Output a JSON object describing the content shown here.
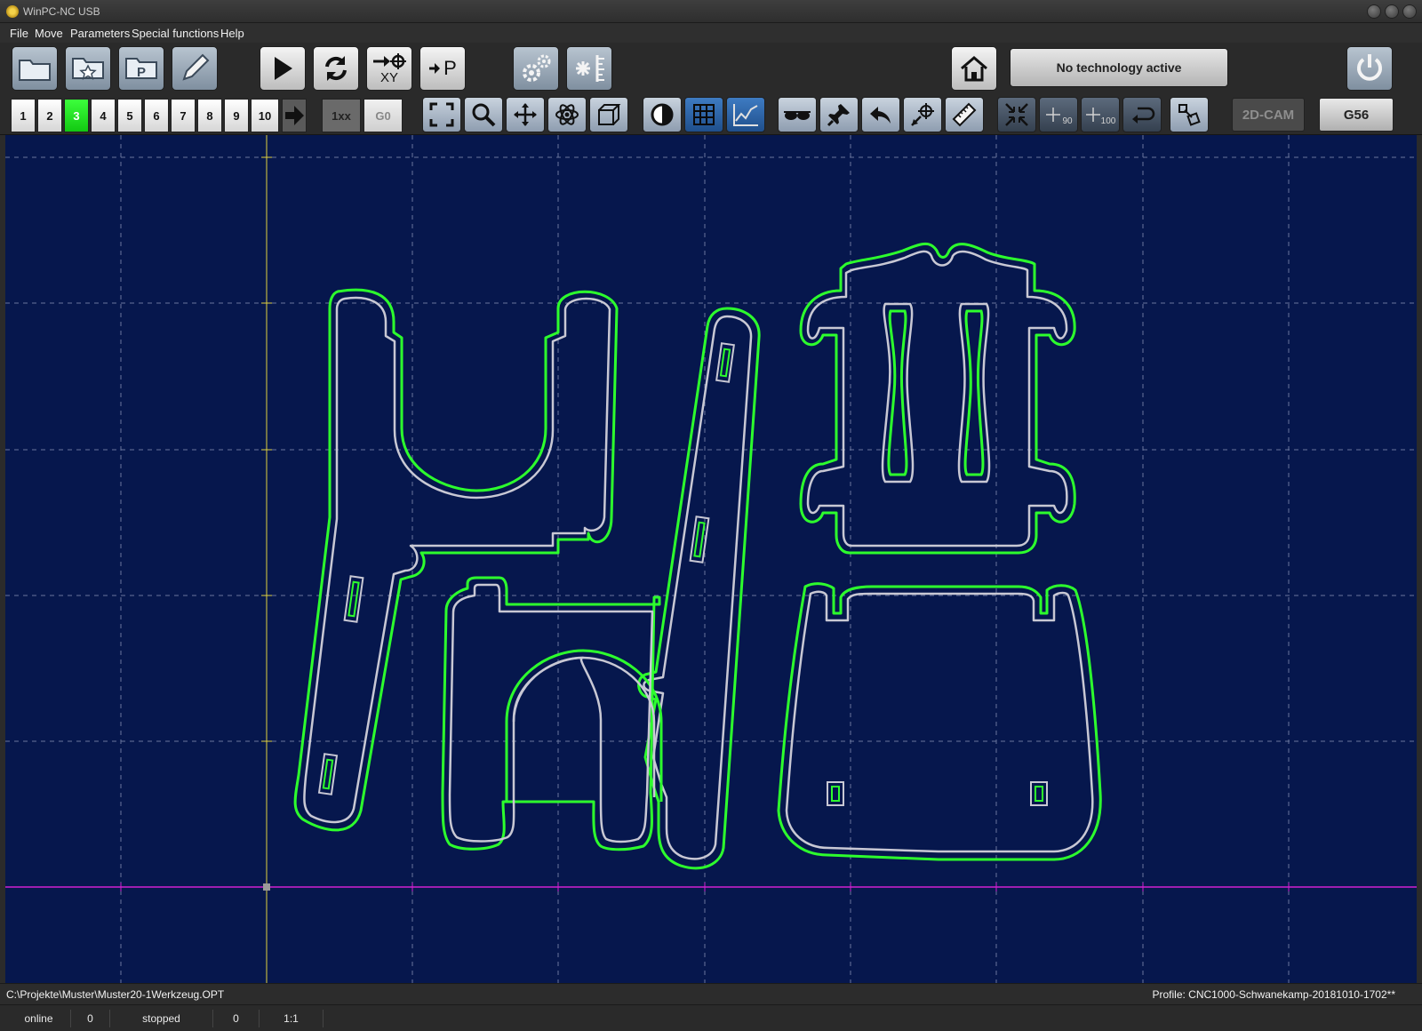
{
  "window": {
    "title": "WinPC-NC USB"
  },
  "menu": {
    "items": [
      "File",
      "Move",
      "Parameters",
      "Special functions",
      "Help"
    ]
  },
  "toolbar1": {
    "buttons": [
      "open-folder-icon",
      "favorites-folder-icon",
      "parameter-folder-icon",
      "edit-pencil-icon",
      "start-play-icon",
      "repeat-icon",
      "goto-xy-icon",
      "goto-park-icon",
      "settings-gears-icon",
      "star-ruler-icon",
      "home-icon",
      "power-icon"
    ],
    "xy_label": "XY",
    "park_label": "P",
    "technology_status": "No technology active"
  },
  "toolbar2": {
    "tool_numbers": [
      "1",
      "2",
      "3",
      "4",
      "5",
      "6",
      "7",
      "8",
      "9",
      "10"
    ],
    "active_tool": "3",
    "mode_1xx": "1xx",
    "mode_g0": "G0",
    "view_buttons": [
      "fit-view-icon",
      "zoom-icon",
      "pan-icon",
      "atom-icon",
      "3d-box-icon",
      "contrast-icon",
      "grid-icon",
      "chart-icon",
      "glasses-icon",
      "pin-icon",
      "undo-arrow-icon",
      "target-arrow-icon",
      "ruler-icon",
      "shrink-icon",
      "rotate-90-icon",
      "rotate-100-icon",
      "return-icon",
      "transform-icon"
    ],
    "rotate_90_label": "90",
    "rotate_100_label": "100",
    "cam_label": "2D-CAM",
    "workpiece_label": "G56"
  },
  "canvas": {
    "background": "#06174d",
    "grid_color": "#8a96b8",
    "contour_color": "#2dff2d",
    "part_color": "#c8c8d4",
    "x_axis_color": "#d020d0",
    "y_axis_color": "#e0d040"
  },
  "pathbar": {
    "file_path": "C:\\Projekte\\Muster\\Muster20-1Werkzeug.OPT",
    "profile": "Profile: CNC1000-Schwanekamp-20181010-1702**"
  },
  "status": {
    "connection": "online",
    "value1": "0",
    "state": "stopped",
    "value2": "0",
    "scale": "1:1"
  }
}
